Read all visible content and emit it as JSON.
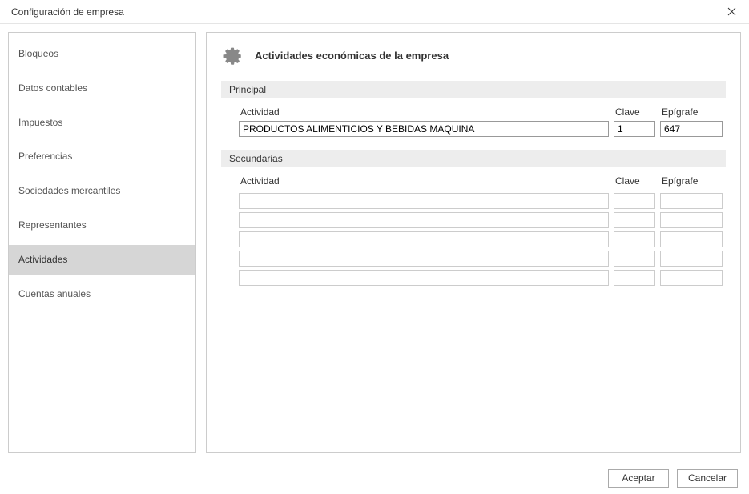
{
  "window": {
    "title": "Configuración de empresa"
  },
  "sidebar": {
    "items": [
      {
        "label": "Bloqueos"
      },
      {
        "label": "Datos contables"
      },
      {
        "label": "Impuestos"
      },
      {
        "label": "Preferencias"
      },
      {
        "label": "Sociedades mercantiles"
      },
      {
        "label": "Representantes"
      },
      {
        "label": "Actividades"
      },
      {
        "label": "Cuentas anuales"
      }
    ],
    "active_index": 6
  },
  "panel": {
    "title": "Actividades económicas de la empresa",
    "principal": {
      "header": "Principal",
      "labels": {
        "actividad": "Actividad",
        "clave": "Clave",
        "epigrafe": "Epígrafe"
      },
      "row": {
        "actividad": "PRODUCTOS ALIMENTICIOS Y BEBIDAS MAQUINA",
        "clave": "1",
        "epigrafe": "647"
      }
    },
    "secundarias": {
      "header": "Secundarias",
      "labels": {
        "actividad": "Actividad",
        "clave": "Clave",
        "epigrafe": "Epígrafe"
      },
      "rows": [
        {
          "actividad": "",
          "clave": "",
          "epigrafe": ""
        },
        {
          "actividad": "",
          "clave": "",
          "epigrafe": ""
        },
        {
          "actividad": "",
          "clave": "",
          "epigrafe": ""
        },
        {
          "actividad": "",
          "clave": "",
          "epigrafe": ""
        },
        {
          "actividad": "",
          "clave": "",
          "epigrafe": ""
        }
      ]
    }
  },
  "footer": {
    "accept": "Aceptar",
    "cancel": "Cancelar"
  }
}
